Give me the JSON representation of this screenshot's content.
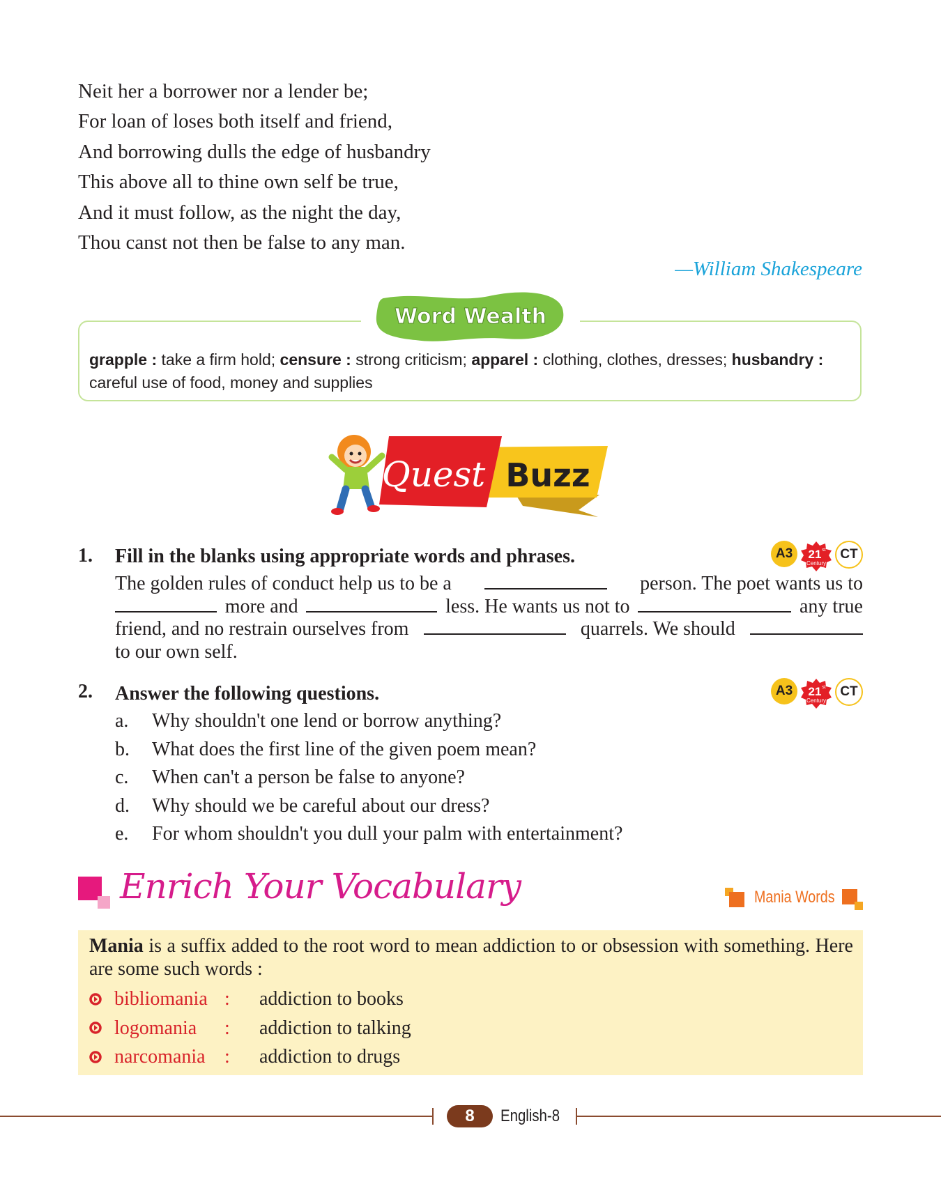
{
  "poem": {
    "lines": [
      "Neit her a borrower nor a lender be;",
      "For loan of loses both itself and friend,",
      "And borrowing dulls the edge of husbandry",
      "This above all to thine own self be true,",
      "And it must follow, as the night the day,",
      "Thou canst not then be false to any man."
    ],
    "author": "—William Shakespeare"
  },
  "word_wealth": {
    "title": "Word Wealth",
    "entries": [
      {
        "term": "grapple :",
        "def": " take a firm hold; "
      },
      {
        "term": "censure :",
        "def": " strong criticism; "
      },
      {
        "term": "apparel :",
        "def": " clothing, clothes, dresses; "
      },
      {
        "term": "husbandry :",
        "def": " careful use of food, money and supplies"
      }
    ]
  },
  "quest_buzz": {
    "word1": "Quest",
    "word2": "Buzz"
  },
  "badges": {
    "a3": "A3",
    "century_num": "21",
    "century_sup": "st",
    "century_word": "Century",
    "ct": "CT"
  },
  "q1": {
    "number": "1.",
    "heading": "Fill in the blanks using appropriate words and phrases.",
    "parts": {
      "p1": "The golden rules of conduct help us to be a",
      "p2": "person. The poet wants us to",
      "p3": "more and",
      "p4": "less. He wants us not to",
      "p5": "any true",
      "p6": "friend, and no restrain ourselves from",
      "p7": "quarrels. We should",
      "p8": "to our own self."
    }
  },
  "q2": {
    "number": "2.",
    "heading": "Answer the following questions.",
    "items": [
      {
        "letter": "a.",
        "text": "Why shouldn't one lend or borrow anything?"
      },
      {
        "letter": "b.",
        "text": "What does the first line of the given poem mean?"
      },
      {
        "letter": "c.",
        "text": "When can't a person be false to anyone?"
      },
      {
        "letter": "d.",
        "text": "Why should we be careful about our dress?"
      },
      {
        "letter": "e.",
        "text": "For whom shouldn't you dull your palm with entertainment?"
      }
    ]
  },
  "enrich": {
    "title": "Enrich Your Vocabulary",
    "label": "Mania Words",
    "intro_bold": "Mania",
    "intro_rest": " is a suffix added to the root word to mean addiction to or obsession with something. Here are some such words :",
    "words": [
      {
        "word": "bibliomania",
        "colon": ":",
        "meaning": "addiction to books"
      },
      {
        "word": "logomania",
        "colon": ":",
        "meaning": "addiction to talking"
      },
      {
        "word": "narcomania",
        "colon": ":",
        "meaning": "addiction to drugs"
      }
    ]
  },
  "footer": {
    "page": "8",
    "title": "English-8"
  },
  "colors": {
    "author_blue": "#1aa3d9",
    "word_wealth_green": "#7cc242",
    "quest_red": "#e31f26",
    "buzz_yellow": "#f8c51c",
    "enrich_pink": "#d61c8b",
    "mania_orange": "#ee6f1f",
    "mania_bg": "#fdf2c4",
    "footer_brown": "#7b3a1d"
  }
}
